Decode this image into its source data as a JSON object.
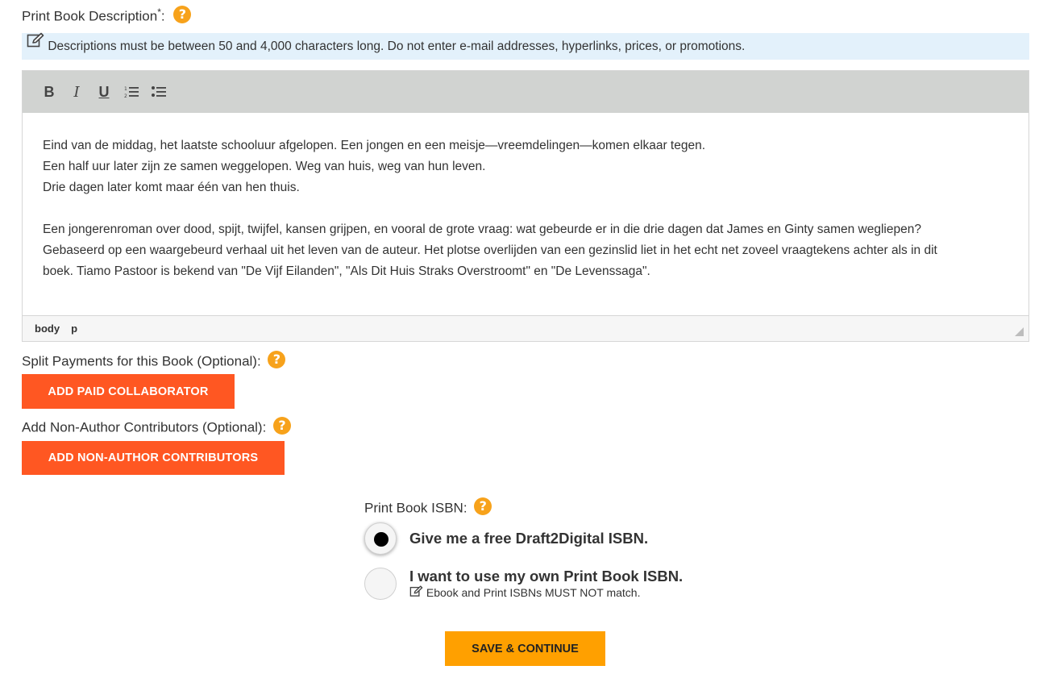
{
  "description": {
    "label": "Print Book Description",
    "required_mark": "*",
    "colon": ":",
    "help": "?",
    "info_text": "Descriptions must be between 50 and 4,000 characters long. Do not enter e-mail addresses, hyperlinks, prices, or promotions.",
    "toolbar": {
      "bold": "B",
      "italic": "I",
      "underline": "U"
    },
    "paragraphs": [
      "Eind van de middag, het laatste schooluur afgelopen. Een jongen en een meisje—vreemdelingen—komen elkaar tegen.",
      "Een half uur later zijn ze samen weggelopen. Weg van huis, weg van hun leven.",
      "Drie dagen later komt maar één van hen thuis.",
      "Een jongerenroman over dood, spijt, twijfel, kansen grijpen, en vooral de grote vraag: wat gebeurde er in die drie dagen dat James en Ginty samen wegliepen?",
      "Gebaseerd op een waargebeurd verhaal uit het leven van de auteur. Het plotse overlijden van een gezinslid liet in het echt net zoveel vraagtekens achter als in dit",
      "boek. Tiamo Pastoor is bekend van \"De Vijf Eilanden\", \"Als Dit Huis Straks Overstroomt\" en \"De Levenssaga\"."
    ],
    "status_path": [
      "body",
      "p"
    ]
  },
  "split_payments": {
    "label": "Split Payments for this Book (Optional):",
    "help": "?",
    "button": "ADD PAID COLLABORATOR"
  },
  "contributors": {
    "label": "Add Non-Author Contributors (Optional):",
    "help": "?",
    "button": "ADD NON-AUTHOR CONTRIBUTORS"
  },
  "isbn": {
    "label": "Print Book ISBN:",
    "help": "?",
    "options": [
      {
        "label": "Give me a free Draft2Digital ISBN.",
        "selected": true
      },
      {
        "label": "I want to use my own Print Book ISBN.",
        "selected": false,
        "note": "Ebook and Print ISBNs MUST NOT match."
      }
    ]
  },
  "save_button": "SAVE & CONTINUE",
  "colors": {
    "accent_red": "#ff5722",
    "accent_orange": "#ffa000",
    "help_orange": "#f7a21b",
    "info_bg": "#e3f1fb",
    "toolbar_bg": "#d1d3d1"
  }
}
